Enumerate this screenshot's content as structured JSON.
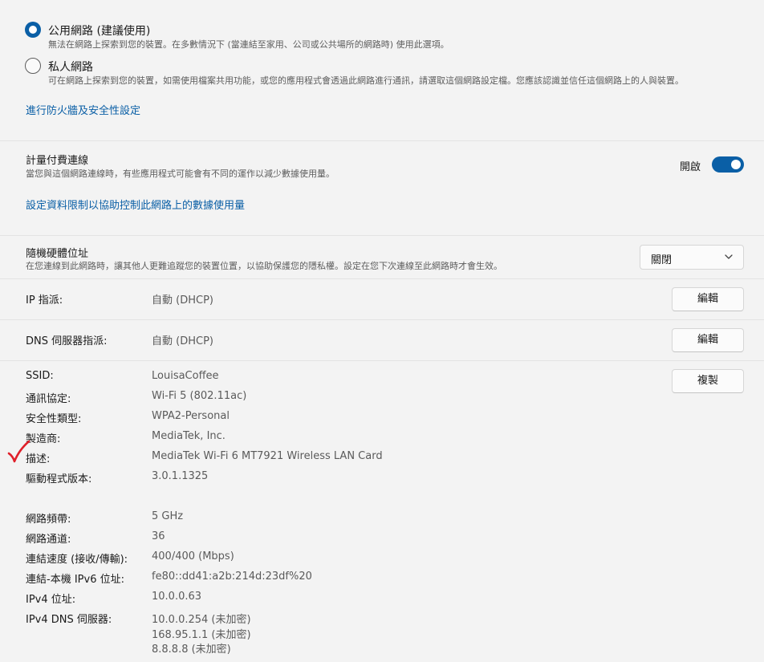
{
  "network_profile": {
    "public": {
      "title": "公用網路 (建議使用)",
      "desc": "無法在網路上探索到您的裝置。在多數情況下 (當連結至家用、公司或公共場所的網路時) 使用此選項。",
      "selected": true
    },
    "private": {
      "title": "私人網路",
      "desc": "可在網路上探索到您的裝置，如需使用檔案共用功能，或您的應用程式會透過此網路進行通訊，請選取這個網路設定檔。您應該認識並信任這個網路上的人與裝置。",
      "selected": false
    },
    "firewall_link": "進行防火牆及安全性設定"
  },
  "metered": {
    "title": "計量付費連線",
    "desc": "當您與這個網路連線時，有些應用程式可能會有不同的運作以減少數據使用量。",
    "toggle_label": "開啟",
    "toggle_on": true,
    "data_limit_link": "設定資料限制以協助控制此網路上的數據使用量"
  },
  "random_mac": {
    "title": "隨機硬體位址",
    "desc": "在您連線到此網路時，讓其他人更難追蹤您的裝置位置，以協助保護您的隱私權。設定在您下次連線至此網路時才會生效。",
    "select_value": "關閉"
  },
  "ip_assignment": {
    "label": "IP 指派:",
    "value": "自動 (DHCP)",
    "button": "編輯"
  },
  "dns_assignment": {
    "label": "DNS 伺服器指派:",
    "value": "自動 (DHCP)",
    "button": "編輯"
  },
  "properties": {
    "copy_button": "複製",
    "rows": [
      {
        "label": "SSID:",
        "value": "LouisaCoffee"
      },
      {
        "label": "通訊協定:",
        "value": "Wi-Fi 5 (802.11ac)"
      },
      {
        "label": "安全性類型:",
        "value": "WPA2-Personal"
      },
      {
        "label": "製造商:",
        "value": "MediaTek, Inc."
      },
      {
        "label": "描述:",
        "value": "MediaTek Wi-Fi 6 MT7921 Wireless LAN Card"
      },
      {
        "label": "驅動程式版本:",
        "value": "3.0.1.1325"
      },
      {
        "label": "網路頻帶:",
        "value": "5 GHz"
      },
      {
        "label": "網路通道:",
        "value": "36"
      },
      {
        "label": "連結速度 (接收/傳輸):",
        "value": "400/400 (Mbps)"
      },
      {
        "label": "連結-本機 IPv6 位址:",
        "value": "fe80::dd41:a2b:214d:23df%20"
      },
      {
        "label": "IPv4 位址:",
        "value": "10.0.0.63"
      },
      {
        "label": "IPv4 DNS 伺服器:",
        "value": "10.0.0.254 (未加密)"
      }
    ],
    "dns_extra": [
      "168.95.1.1 (未加密)",
      "8.8.8.8 (未加密)"
    ]
  },
  "colors": {
    "accent": "#0a5fa6",
    "annotation": "#e0202a"
  }
}
